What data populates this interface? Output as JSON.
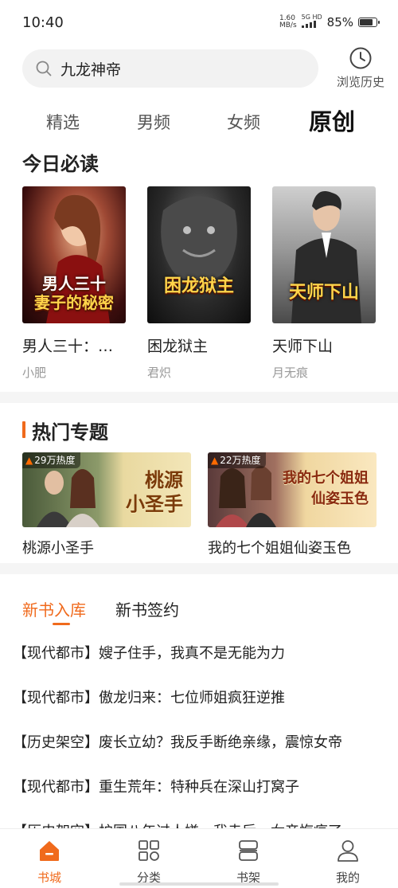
{
  "status_bar": {
    "time": "10:40",
    "net_speed_value": "1.60",
    "net_speed_unit": "MB/s",
    "signal_label": "5G HD",
    "battery_percent": "85%",
    "battery_level": 0.85
  },
  "search": {
    "query": "九龙神帝",
    "icon": "search-icon"
  },
  "history": {
    "label": "浏览历史",
    "icon": "clock-icon"
  },
  "channel_tabs": [
    {
      "label": "精选",
      "active": false
    },
    {
      "label": "男频",
      "active": false
    },
    {
      "label": "女频",
      "active": false
    },
    {
      "label": "原创",
      "active": true
    }
  ],
  "today_reads": {
    "title": "今日必读",
    "books": [
      {
        "title": "男人三十：…",
        "author": "小肥",
        "cover_text_1": "男人三十",
        "cover_text_2": "妻子的秘密"
      },
      {
        "title": "困龙狱主",
        "author": "君炽",
        "cover_text_1": "困龙狱主",
        "cover_text_2": ""
      },
      {
        "title": "天师下山",
        "author": "月无痕",
        "cover_text_1": "天师下山",
        "cover_text_2": ""
      }
    ]
  },
  "hot_topics": {
    "title": "热门专题",
    "items": [
      {
        "heat": "29万热度",
        "name": "桃源小圣手",
        "art_line_1": "桃源",
        "art_line_2": "小圣手"
      },
      {
        "heat": "22万热度",
        "name": "我的七个姐姐仙姿玉色",
        "art_line_1": "我的七个姐姐",
        "art_line_2": "仙姿玉色"
      }
    ]
  },
  "new_books": {
    "tabs": [
      {
        "label": "新书入库",
        "active": true
      },
      {
        "label": "新书签约",
        "active": false
      }
    ],
    "items": [
      "【现代都市】嫂子住手，我真不是无能为力",
      "【现代都市】傲龙归来：七位师姐疯狂逆推",
      "【历史架空】废长立幼？我反手断绝亲缘，震惊女帝",
      "【现代都市】重生荒年：特种兵在深山打窝子",
      "【历史架空】护国八年过人嫌，我走后，女帝悔疯了"
    ]
  },
  "bottom_nav": [
    {
      "label": "书城",
      "icon": "home-icon",
      "active": true
    },
    {
      "label": "分类",
      "icon": "category-grid-icon",
      "active": false
    },
    {
      "label": "书架",
      "icon": "bookshelf-icon",
      "active": false
    },
    {
      "label": "我的",
      "icon": "profile-icon",
      "active": false
    }
  ],
  "colors": {
    "accent": "#f06a1c",
    "text": "#222222",
    "muted": "#999999"
  }
}
